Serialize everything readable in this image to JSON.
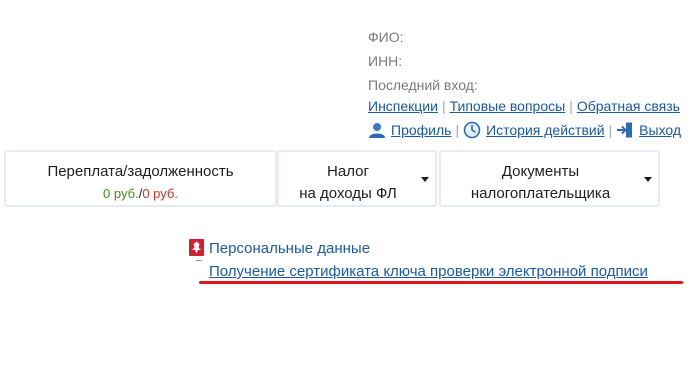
{
  "user": {
    "fio_label": "ФИО:",
    "inn_label": "ИНН:",
    "last_login_label": "Последний вход:"
  },
  "top_links": {
    "inspections": "Инспекции",
    "faq": "Типовые вопросы",
    "feedback": "Обратная связь"
  },
  "account_links": {
    "profile": "Профиль",
    "history": "История действий",
    "logout": "Выход"
  },
  "tabs": [
    {
      "line1": "Переплата/задолженность",
      "overpay": "0 руб.",
      "divider": "/",
      "debt": "0 руб."
    },
    {
      "line1": "Налог",
      "line2": "на доходы ФЛ"
    },
    {
      "line1": "Документы",
      "line2": "налогоплательщика"
    }
  ],
  "personal": {
    "title": "Персональные данные",
    "certificate_link": "Получение сертификата ключа проверки электронной подписи"
  },
  "colors": {
    "link": "#1a5aa5",
    "highlight_underline": "#e4141c",
    "overpay_green": "#4a8a1e",
    "debt_red": "#c0392b"
  }
}
